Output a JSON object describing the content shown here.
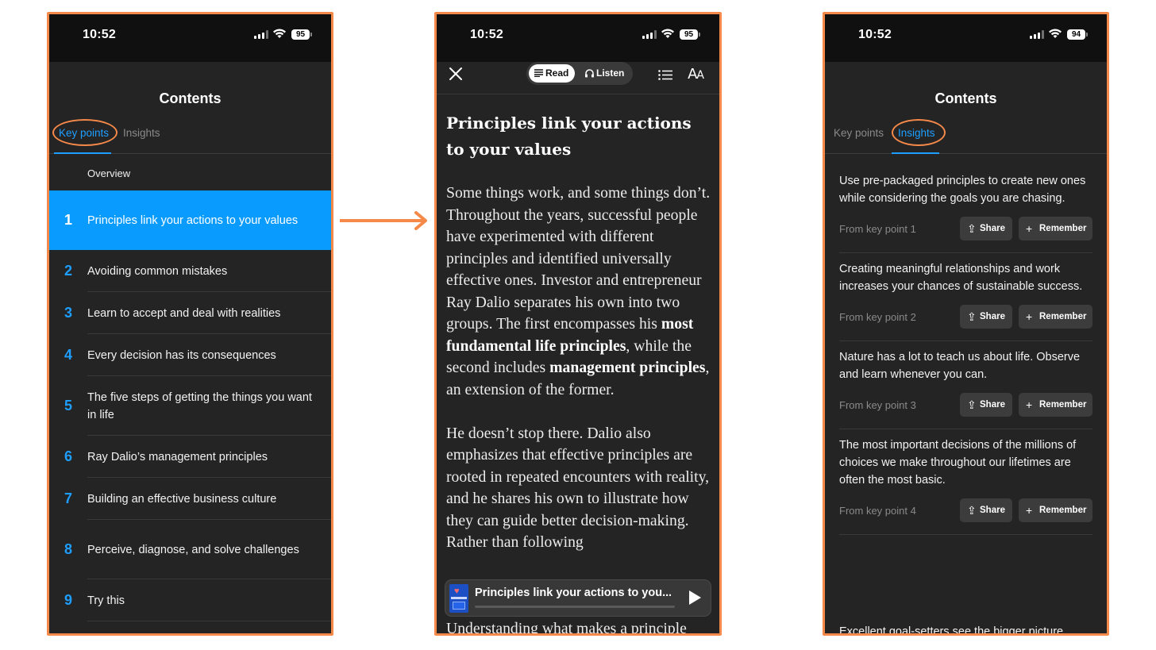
{
  "status": {
    "p1": {
      "time": "10:52",
      "battery": "95"
    },
    "p2": {
      "time": "10:52",
      "battery": "95"
    },
    "p3": {
      "time": "10:52",
      "battery": "94"
    }
  },
  "contents": {
    "title": "Contents",
    "tab_key_points": "Key points",
    "tab_insights": "Insights",
    "overview": "Overview",
    "key_points": [
      {
        "num": "1",
        "text": "Principles link your actions to your values"
      },
      {
        "num": "2",
        "text": "Avoiding common mistakes"
      },
      {
        "num": "3",
        "text": "Learn to accept and deal with realities"
      },
      {
        "num": "4",
        "text": "Every decision has its consequences"
      },
      {
        "num": "5",
        "text": "The five steps of getting the things you want in life"
      },
      {
        "num": "6",
        "text": "Ray Dalio’s management principles"
      },
      {
        "num": "7",
        "text": "Building an effective business culture"
      },
      {
        "num": "8",
        "text": "Perceive, diagnose, and solve challenges"
      },
      {
        "num": "9",
        "text": "Try this"
      }
    ]
  },
  "reader": {
    "read_label": "Read",
    "listen_label": "Listen",
    "font_label_big": "A",
    "font_label_small": "A",
    "title": "Principles link your actions to your values",
    "p1_a": "Some things work, and some things don’t. Throughout the years, successful people have experimented with different principles and identified universally effective ones. Investor and entrepreneur Ray Dalio separates his own into two groups. The first encompasses his ",
    "p1_b1": "most fundamental life principles",
    "p1_c": ", while the second includes ",
    "p1_b2": "management principles",
    "p1_d": ", an extension of the former.",
    "p2": "He doesn’t stop there. Dalio also emphasizes that effective principles are rooted in repeated encounters with reality, and he shares his own to illustrate how they can guide better decision-making. Rather than following",
    "tail": "Understanding what makes a principle",
    "player_title": "Principles link your actions to you..."
  },
  "insights": {
    "share_label": "Share",
    "remember_label": "Remember",
    "items": [
      {
        "text": "Use pre-packaged principles to create new ones while considering the goals you are chasing.",
        "from": "From key point 1"
      },
      {
        "text": "Creating meaningful relationships and work increases your chances of sustainable success.",
        "from": "From key point 2"
      },
      {
        "text": "Nature has a lot to teach us about life. Observe and learn whenever you can.",
        "from": "From key point 3"
      },
      {
        "text": "The most important decisions of the millions of choices we make throughout our lifetimes are often the most basic.",
        "from": "From key point 4"
      }
    ],
    "partial": "Excellent goal-setters see the bigger picture"
  },
  "colors": {
    "accent": "#1e9fff",
    "active_row": "#0a9bff",
    "frame": "#f5894a",
    "bg": "#242424"
  }
}
